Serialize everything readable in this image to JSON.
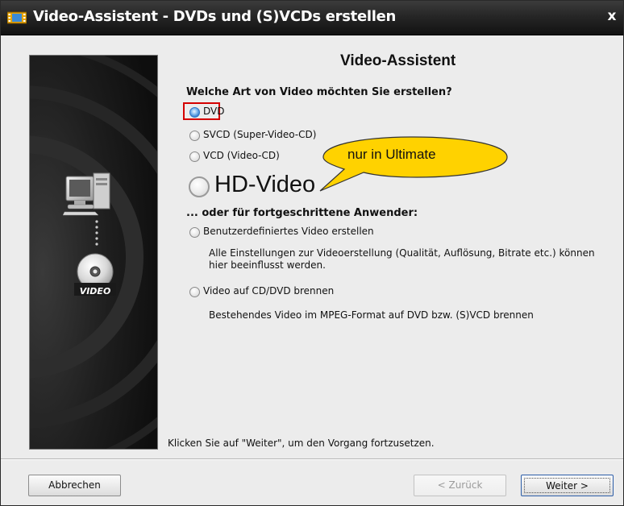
{
  "window": {
    "title": "Video-Assistent - DVDs und (S)VCDs erstellen",
    "close_glyph": "x"
  },
  "main": {
    "heading": "Video-Assistent",
    "question": "Welche Art von Video möchten Sie erstellen?",
    "options": [
      {
        "label": "DVD",
        "selected": true
      },
      {
        "label": "SVCD (Super-Video-CD)",
        "selected": false
      },
      {
        "label": "VCD (Video-CD)",
        "selected": false
      },
      {
        "label": "HD-Video",
        "selected": false
      }
    ],
    "callout": "nur in Ultimate",
    "advanced_heading": "... oder für fortgeschrittene Anwender:",
    "advanced_options": [
      {
        "label": "Benutzerdefiniertes Video erstellen",
        "description": "Alle Einstellungen zur Videoerstellung (Qualität, Auflösung, Bitrate etc.) können hier beeinflusst werden.",
        "selected": false
      },
      {
        "label": "Video auf CD/DVD brennen",
        "description": "Bestehendes Video im MPEG-Format auf DVD bzw. (S)VCD brennen",
        "selected": false
      }
    ],
    "footer_hint": "Klicken Sie auf \"Weiter\", um den Vorgang fortzusetzen."
  },
  "sidebar": {
    "disc_label": "VIDEO"
  },
  "buttons": {
    "cancel": "Abbrechen",
    "back": "< Zurück",
    "next": "Weiter >"
  },
  "colors": {
    "titlebar": "#1e1e1e",
    "highlight_border": "#d40000",
    "callout_fill": "#ffd200",
    "radio_selected": "#3d86d3"
  }
}
